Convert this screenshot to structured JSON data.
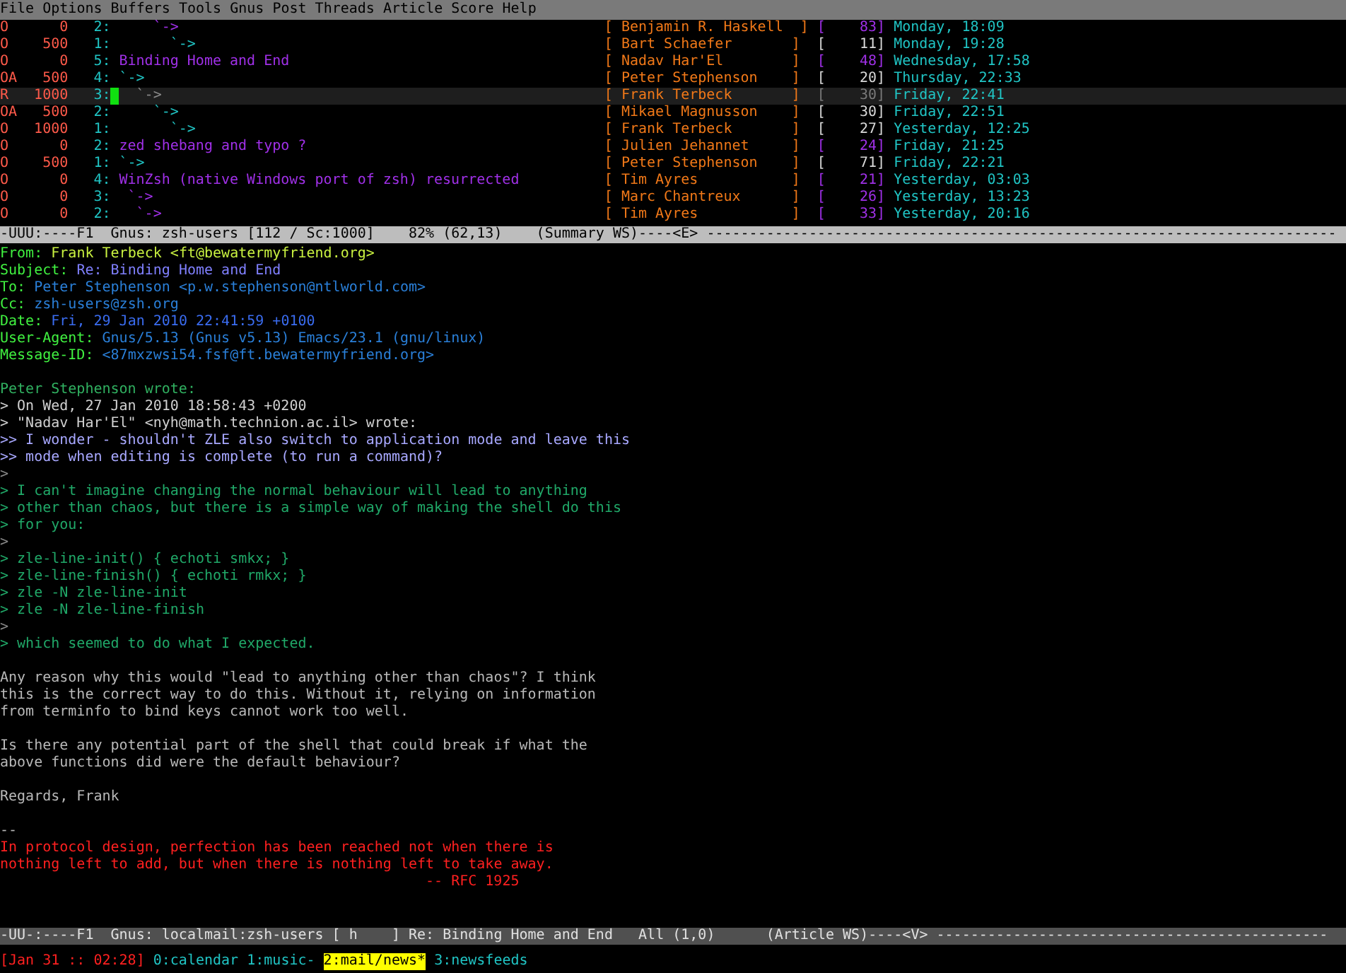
{
  "menu_bar": [
    "File",
    "Options",
    "Buffers",
    "Tools",
    "Gnus",
    "Post",
    "Threads",
    "Article",
    "Score",
    "Help"
  ],
  "summary": {
    "rows": [
      {
        "mark": "O",
        "score": "0",
        "number": "2:",
        "subject": "    `->",
        "author": "[ Benjamin R. Haskell  ]",
        "lines": "[    83]",
        "date": "Monday, 18:09",
        "read": false,
        "selected": false
      },
      {
        "mark": "O",
        "score": "500",
        "number": "1:",
        "subject": "      `->",
        "author": "[ Bart Schaefer       ]",
        "lines": "[    11]",
        "date": "Monday, 19:28",
        "read": true,
        "selected": false
      },
      {
        "mark": "O",
        "score": "0",
        "number": "5:",
        "subject": "Binding Home and End",
        "author": "[ Nadav Har'El        ]",
        "lines": "[    48]",
        "date": "Wednesday, 17:58",
        "read": false,
        "selected": false
      },
      {
        "mark": "OA",
        "score": "500",
        "number": "4:",
        "subject": "`->",
        "author": "[ Peter Stephenson    ]",
        "lines": "[    20]",
        "date": "Thursday, 22:33",
        "read": true,
        "selected": false
      },
      {
        "mark": "R",
        "score": "1000",
        "number": "3:",
        "subject": "  `->",
        "author": "[ Frank Terbeck       ]",
        "lines": "[    30]",
        "date": "Friday, 22:41",
        "read": true,
        "selected": true
      },
      {
        "mark": "OA",
        "score": "500",
        "number": "2:",
        "subject": "    `->",
        "author": "[ Mikael Magnusson    ]",
        "lines": "[    30]",
        "date": "Friday, 22:51",
        "read": true,
        "selected": false
      },
      {
        "mark": "O",
        "score": "1000",
        "number": "1:",
        "subject": "      `->",
        "author": "[ Frank Terbeck       ]",
        "lines": "[    27]",
        "date": "Yesterday, 12:25",
        "read": true,
        "selected": false
      },
      {
        "mark": "O",
        "score": "0",
        "number": "2:",
        "subject": "zed shebang and typo ?",
        "author": "[ Julien Jehannet     ]",
        "lines": "[    24]",
        "date": "Friday, 21:25",
        "read": false,
        "selected": false
      },
      {
        "mark": "O",
        "score": "500",
        "number": "1:",
        "subject": "`->",
        "author": "[ Peter Stephenson    ]",
        "lines": "[    71]",
        "date": "Friday, 22:21",
        "read": true,
        "selected": false
      },
      {
        "mark": "O",
        "score": "0",
        "number": "4:",
        "subject": "WinZsh (native Windows port of zsh) resurrected",
        "author": "[ Tim Ayres           ]",
        "lines": "[    21]",
        "date": "Yesterday, 03:03",
        "read": false,
        "selected": false
      },
      {
        "mark": "O",
        "score": "0",
        "number": "3:",
        "subject": " `->",
        "author": "[ Marc Chantreux      ]",
        "lines": "[    26]",
        "date": "Yesterday, 13:23",
        "read": false,
        "selected": false
      },
      {
        "mark": "O",
        "score": "0",
        "number": "2:",
        "subject": "  `->",
        "author": "[ Tim Ayres           ]",
        "lines": "[    33]",
        "date": "Yesterday, 20:16",
        "read": false,
        "selected": false
      }
    ],
    "mode_line": {
      "text": "-UUU:----F1  Gnus: zsh-users [112 / Sc:1000]    82% (62,13)    (Summary WS)----<E> --------------------------------------------------------------------------",
      "active": true
    }
  },
  "article": {
    "headers": [
      {
        "label": "From:",
        "value": "Frank Terbeck <ft@bewatermyfriend.org>",
        "color": "#c8f040"
      },
      {
        "label": "Subject:",
        "value": "Re: Binding Home and End",
        "color": "#8080ff"
      },
      {
        "label": "To:",
        "value": "Peter Stephenson <p.w.stephenson@ntlworld.com>",
        "color": "#2a7fd8"
      },
      {
        "label": "Cc:",
        "value": "zsh-users@zsh.org",
        "color": "#2a7fd8"
      },
      {
        "label": "Date:",
        "value": "Fri, 29 Jan 2010 22:41:59 +0100",
        "color": "#3a6cf0"
      },
      {
        "label": "User-Agent:",
        "value": "Gnus/5.13 (Gnus v5.13) Emacs/23.1 (gnu/linux)",
        "color": "#2a7fd8"
      },
      {
        "label": "Message-ID:",
        "value": "<87mxzwsi54.fsf@ft.bewatermyfriend.org>",
        "color": "#2a7fd8"
      }
    ],
    "body": [
      {
        "lines": [
          {
            "kind": "attribution",
            "text": "Peter Stephenson wrote:"
          },
          {
            "kind": "quote-header",
            "text": "> On Wed, 27 Jan 2010 18:58:43 +0200"
          },
          {
            "kind": "quote-header",
            "text": "> \"Nadav Har'El\" <nyh@math.technion.ac.il> wrote:"
          },
          {
            "kind": "quote2",
            "text": ">> I wonder - shouldn't ZLE also switch to application mode and leave this"
          },
          {
            "kind": "quote2",
            "text": ">> mode when editing is complete (to run a command)?"
          },
          {
            "kind": "quote-empty",
            "text": ">"
          },
          {
            "kind": "quote1",
            "text": "> I can't imagine changing the normal behaviour will lead to anything"
          },
          {
            "kind": "quote1",
            "text": "> other than chaos, but there is a simple way of making the shell do this"
          },
          {
            "kind": "quote1",
            "text": "> for you:"
          },
          {
            "kind": "quote-empty",
            "text": ">"
          },
          {
            "kind": "quote1",
            "text": "> zle-line-init() { echoti smkx; }"
          },
          {
            "kind": "quote1",
            "text": "> zle-line-finish() { echoti rmkx; }"
          },
          {
            "kind": "quote1",
            "text": "> zle -N zle-line-init"
          },
          {
            "kind": "quote1",
            "text": "> zle -N zle-line-finish"
          },
          {
            "kind": "quote-empty",
            "text": ">"
          },
          {
            "kind": "quote1",
            "text": "> which seemed to do what I expected."
          }
        ]
      },
      {
        "lines": [
          {
            "kind": "text",
            "text": "Any reason why this would \"lead to anything other than chaos\"? I think"
          },
          {
            "kind": "text",
            "text": "this is the correct way to do this. Without it, relying on information"
          },
          {
            "kind": "text",
            "text": "from terminfo to bind keys cannot work too well."
          }
        ]
      },
      {
        "lines": [
          {
            "kind": "text",
            "text": "Is there any potential part of the shell that could break if what the"
          },
          {
            "kind": "text",
            "text": "above functions did were the default behaviour?"
          }
        ]
      },
      {
        "lines": [
          {
            "kind": "text",
            "text": "Regards, Frank"
          }
        ]
      },
      {
        "lines": [
          {
            "kind": "sig-separator",
            "text": "--"
          },
          {
            "kind": "signature",
            "text": "In protocol design, perfection has been reached not when there is"
          },
          {
            "kind": "signature",
            "text": "nothing left to add, but when there is nothing left to take away."
          },
          {
            "kind": "signature-source",
            "text": "-- RFC 1925"
          }
        ]
      }
    ],
    "mode_line": {
      "text": "-UU-:----F1  Gnus: localmail:zsh-users [ h    ] Re: Binding Home and End   All (1,0)      (Article WS)----<V> ----------------------------------------------",
      "active": false
    }
  },
  "status_bar": {
    "clock": "[Jan 31 :: 02:28]",
    "windows": [
      {
        "label": "0:calendar",
        "selected": false
      },
      {
        "label": "1:music-",
        "selected": false
      },
      {
        "label": "2:mail/news*",
        "selected": true
      },
      {
        "label": "3:newsfeeds",
        "selected": false
      }
    ]
  }
}
